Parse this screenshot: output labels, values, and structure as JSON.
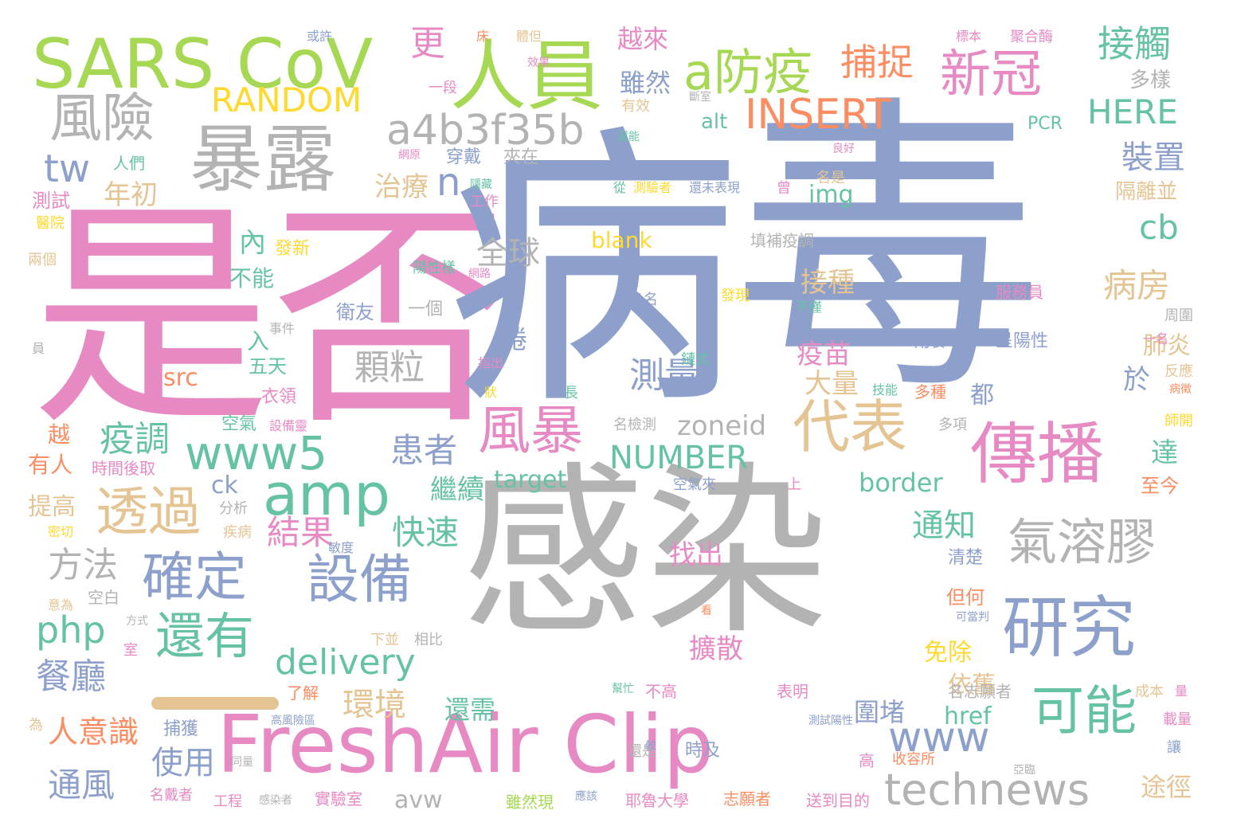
{
  "palette": {
    "pink": "#e78ac3",
    "blue": "#8da0cb",
    "green": "#66c2a5",
    "lime": "#a6d854",
    "gray": "#b3b3b3",
    "tan": "#e5c494",
    "orange": "#fc8d62",
    "yellow": "#ffd92f"
  },
  "words": [
    {
      "text": "是否",
      "color": "pink"
    },
    {
      "text": "病",
      "color": "blue"
    },
    {
      "text": "毒",
      "color": "blue"
    },
    {
      "text": "感染",
      "color": "gray"
    },
    {
      "text": "FreshAir Clip",
      "color": "pink"
    },
    {
      "text": "SARS CoV",
      "color": "lime"
    },
    {
      "text": "人員",
      "color": "lime"
    },
    {
      "text": "暴露",
      "color": "gray"
    },
    {
      "text": "傳播",
      "color": "pink"
    },
    {
      "text": "研究",
      "color": "blue"
    },
    {
      "text": "a防疫",
      "color": "lime"
    },
    {
      "text": "新冠",
      "color": "pink"
    },
    {
      "text": "風險",
      "color": "gray"
    },
    {
      "text": "a4b3f35b",
      "color": "gray"
    },
    {
      "text": "amp",
      "color": "green"
    },
    {
      "text": "www5",
      "color": "green"
    },
    {
      "text": "代表",
      "color": "tan"
    },
    {
      "text": "風暴",
      "color": "pink"
    },
    {
      "text": "確定",
      "color": "blue"
    },
    {
      "text": "設備",
      "color": "blue"
    },
    {
      "text": "透過",
      "color": "tan"
    },
    {
      "text": "還有",
      "color": "green"
    },
    {
      "text": "可能",
      "color": "green"
    },
    {
      "text": "氣溶膠",
      "color": "gray"
    },
    {
      "text": "technews",
      "color": "gray"
    },
    {
      "text": "delivery",
      "color": "green"
    },
    {
      "text": "www",
      "color": "blue"
    },
    {
      "text": "INSERT",
      "color": "orange"
    },
    {
      "text": "RANDOM",
      "color": "yellow"
    },
    {
      "text": "捕捉",
      "color": "orange"
    },
    {
      "text": "接觸",
      "color": "green"
    },
    {
      "text": "HERE",
      "color": "green"
    },
    {
      "text": "更",
      "color": "pink"
    },
    {
      "text": "tw",
      "color": "blue"
    },
    {
      "text": "n",
      "color": "blue"
    },
    {
      "text": "cb",
      "color": "green"
    },
    {
      "text": "php",
      "color": "green"
    },
    {
      "text": "顆粒",
      "color": "gray"
    },
    {
      "text": "疫調",
      "color": "green"
    },
    {
      "text": "NUMBER",
      "color": "green"
    },
    {
      "text": "測量",
      "color": "blue"
    },
    {
      "text": "患者",
      "color": "blue"
    },
    {
      "text": "結果",
      "color": "pink"
    },
    {
      "text": "快速",
      "color": "green"
    },
    {
      "text": "方法",
      "color": "gray"
    },
    {
      "text": "餐廳",
      "color": "blue"
    },
    {
      "text": "人意識",
      "color": "orange"
    },
    {
      "text": "環境",
      "color": "tan"
    },
    {
      "text": "使用",
      "color": "blue"
    },
    {
      "text": "通風",
      "color": "blue"
    },
    {
      "text": "病房",
      "color": "tan"
    },
    {
      "text": "裝置",
      "color": "blue"
    },
    {
      "text": "通知",
      "color": "green"
    },
    {
      "text": "全球",
      "color": "gray"
    },
    {
      "text": "內",
      "color": "green"
    },
    {
      "text": "年初",
      "color": "tan"
    },
    {
      "text": "治療",
      "color": "tan"
    },
    {
      "text": "雖然",
      "color": "blue"
    },
    {
      "text": "越來",
      "color": "pink"
    },
    {
      "text": "接種",
      "color": "tan"
    },
    {
      "text": "疫苗",
      "color": "pink"
    },
    {
      "text": "大量",
      "color": "tan"
    },
    {
      "text": "達",
      "color": "green"
    },
    {
      "text": "於",
      "color": "blue"
    },
    {
      "text": "肺炎",
      "color": "tan"
    },
    {
      "text": "繼續",
      "color": "green"
    },
    {
      "text": "找出",
      "color": "pink"
    },
    {
      "text": "擴散",
      "color": "pink"
    },
    {
      "text": "依舊",
      "color": "tan"
    },
    {
      "text": "圍堵",
      "color": "blue"
    },
    {
      "text": "免除",
      "color": "yellow"
    },
    {
      "text": "還需",
      "color": "green"
    },
    {
      "text": "途徑",
      "color": "tan"
    },
    {
      "text": "zoneid",
      "color": "gray"
    },
    {
      "text": "border",
      "color": "green"
    },
    {
      "text": "target",
      "color": "green"
    },
    {
      "text": "href",
      "color": "green"
    },
    {
      "text": "img",
      "color": "green"
    },
    {
      "text": "blank",
      "color": "yellow"
    },
    {
      "text": "alt",
      "color": "green"
    },
    {
      "text": "src",
      "color": "orange"
    },
    {
      "text": "ck",
      "color": "blue"
    },
    {
      "text": "avw",
      "color": "gray"
    },
    {
      "text": "PCR",
      "color": "green"
    },
    {
      "text": "多樣",
      "color": "gray"
    },
    {
      "text": "隔離並",
      "color": "tan"
    },
    {
      "text": "反應",
      "color": "tan"
    },
    {
      "text": "至今",
      "color": "orange"
    },
    {
      "text": "但何",
      "color": "orange"
    },
    {
      "text": "捲",
      "color": "blue"
    },
    {
      "text": "都",
      "color": "blue"
    },
    {
      "text": "不能",
      "color": "green"
    },
    {
      "text": "入",
      "color": "green"
    },
    {
      "text": "五天",
      "color": "green"
    },
    {
      "text": "越",
      "color": "orange"
    },
    {
      "text": "有人",
      "color": "orange"
    },
    {
      "text": "提高",
      "color": "tan"
    },
    {
      "text": "測試",
      "color": "pink"
    },
    {
      "text": "醫院",
      "color": "yellow"
    },
    {
      "text": "兩個",
      "color": "tan"
    },
    {
      "text": "人們",
      "color": "green"
    },
    {
      "text": "穿戴",
      "color": "blue"
    },
    {
      "text": "夾在",
      "color": "gray"
    },
    {
      "text": "工作",
      "color": "pink"
    },
    {
      "text": "陽性樣",
      "color": "green"
    },
    {
      "text": "發新",
      "color": "yellow"
    },
    {
      "text": "衛友",
      "color": "blue"
    },
    {
      "text": "一個",
      "color": "gray"
    },
    {
      "text": "事件",
      "color": "gray"
    },
    {
      "text": "員",
      "color": "gray"
    },
    {
      "text": "衣領",
      "color": "pink"
    },
    {
      "text": "空氣",
      "color": "green"
    },
    {
      "text": "設備靈",
      "color": "pink"
    },
    {
      "text": "時間後取",
      "color": "pink"
    },
    {
      "text": "分析",
      "color": "gray"
    },
    {
      "text": "密切",
      "color": "yellow"
    },
    {
      "text": "疾病",
      "color": "tan"
    },
    {
      "text": "敏度",
      "color": "blue"
    },
    {
      "text": "空白",
      "color": "gray"
    },
    {
      "text": "意為",
      "color": "tan"
    },
    {
      "text": "方式",
      "color": "gray"
    },
    {
      "text": "室",
      "color": "pink"
    },
    {
      "text": "下並",
      "color": "tan"
    },
    {
      "text": "相比",
      "color": "gray"
    },
    {
      "text": "了解",
      "color": "orange"
    },
    {
      "text": "為",
      "color": "tan"
    },
    {
      "text": "捕獲",
      "color": "blue"
    },
    {
      "text": "名戴者",
      "color": "pink"
    },
    {
      "text": "工程",
      "color": "pink"
    },
    {
      "text": "感染者",
      "color": "gray"
    },
    {
      "text": "實驗室",
      "color": "pink"
    },
    {
      "text": "雖然現",
      "color": "lime"
    },
    {
      "text": "應該",
      "color": "blue"
    },
    {
      "text": "耶魯大學",
      "color": "pink"
    },
    {
      "text": "志願者",
      "color": "orange"
    },
    {
      "text": "送到目的",
      "color": "pink"
    },
    {
      "text": "高風險區",
      "color": "blue"
    },
    {
      "text": "還是",
      "color": "gray"
    },
    {
      "text": "同量",
      "color": "gray"
    },
    {
      "text": "較",
      "color": "blue"
    },
    {
      "text": "幫忙",
      "color": "green"
    },
    {
      "text": "不高",
      "color": "pink"
    },
    {
      "text": "時及",
      "color": "blue"
    },
    {
      "text": "高",
      "color": "pink"
    },
    {
      "text": "收容所",
      "color": "orange"
    },
    {
      "text": "亞臨",
      "color": "gray"
    },
    {
      "text": "測試陽性",
      "color": "blue"
    },
    {
      "text": "表明",
      "color": "pink"
    },
    {
      "text": "名志願者",
      "color": "gray"
    },
    {
      "text": "成本",
      "color": "tan"
    },
    {
      "text": "量",
      "color": "pink"
    },
    {
      "text": "載量",
      "color": "pink"
    },
    {
      "text": "讓",
      "color": "blue"
    },
    {
      "text": "可當判",
      "color": "blue"
    },
    {
      "text": "清楚",
      "color": "blue"
    },
    {
      "text": "名檢測",
      "color": "gray"
    },
    {
      "text": "多項",
      "color": "gray"
    },
    {
      "text": "技能",
      "color": "green"
    },
    {
      "text": "多種",
      "color": "orange"
    },
    {
      "text": "上",
      "color": "pink"
    },
    {
      "text": "空氣夾",
      "color": "blue"
    },
    {
      "text": "鏈式",
      "color": "green"
    },
    {
      "text": "長",
      "color": "green"
    },
    {
      "text": "狀",
      "color": "yellow"
    },
    {
      "text": "指出",
      "color": "pink"
    },
    {
      "text": "看",
      "color": "orange"
    },
    {
      "text": "一名",
      "color": "pink"
    },
    {
      "text": "病徵",
      "color": "orange"
    },
    {
      "text": "師開",
      "color": "yellow"
    },
    {
      "text": "周圍",
      "color": "gray"
    },
    {
      "text": "呈陽性",
      "color": "blue"
    },
    {
      "text": "用餐",
      "color": "blue"
    },
    {
      "text": "即無症",
      "color": "blue"
    },
    {
      "text": "服務員",
      "color": "pink"
    },
    {
      "text": "發現",
      "color": "yellow"
    },
    {
      "text": "多名",
      "color": "blue"
    },
    {
      "text": "不僅",
      "color": "green"
    },
    {
      "text": "填補疫調",
      "color": "gray"
    },
    {
      "text": "從",
      "color": "green"
    },
    {
      "text": "測驗者",
      "color": "yellow"
    },
    {
      "text": "還未表現",
      "color": "blue"
    },
    {
      "text": "曾",
      "color": "pink"
    },
    {
      "text": "名是",
      "color": "tan"
    },
    {
      "text": "良好",
      "color": "pink"
    },
    {
      "text": "隱藏",
      "color": "green"
    },
    {
      "text": "網原",
      "color": "pink"
    },
    {
      "text": "網路",
      "color": "pink"
    },
    {
      "text": "還能",
      "color": "green"
    },
    {
      "text": "有效",
      "color": "tan"
    },
    {
      "text": "斷室",
      "color": "gray"
    },
    {
      "text": "一段",
      "color": "pink"
    },
    {
      "text": "效果",
      "color": "pink"
    },
    {
      "text": "或許",
      "color": "blue"
    },
    {
      "text": "床",
      "color": "orange"
    },
    {
      "text": "體但",
      "color": "tan"
    },
    {
      "text": "標本",
      "color": "pink"
    },
    {
      "text": "聚合酶",
      "color": "pink"
    }
  ]
}
